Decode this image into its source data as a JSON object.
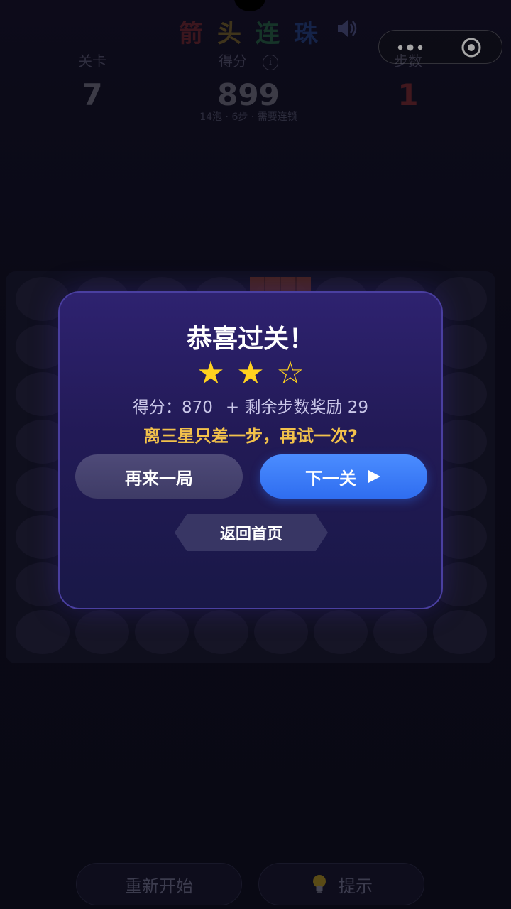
{
  "header": {
    "title_chars": [
      {
        "char": "箭",
        "color": "#e0443a"
      },
      {
        "char": "头",
        "color": "#f4c430"
      },
      {
        "char": "连",
        "color": "#3cc36b"
      },
      {
        "char": "珠",
        "color": "#3b7cf2"
      }
    ],
    "sound_icon": "speaker-icon",
    "capsule": {
      "menu_icon": "more-dots-icon",
      "close_icon": "target-close-icon"
    }
  },
  "stats": {
    "level": {
      "label": "关卡",
      "value": "7",
      "color": "#c9c9d6"
    },
    "score": {
      "label": "得分",
      "value": "899",
      "color": "#c9c9d6",
      "info_glyph": "i"
    },
    "steps": {
      "label": "步数",
      "value": "1",
      "color": "#e0443a"
    },
    "sub_info": "14泡 · 6步 · 需要连锁"
  },
  "board": {
    "rows": 8,
    "cols": 8
  },
  "bottom": {
    "restart_label": "重新开始",
    "hint_label": "提示",
    "hint_icon": "lightbulb-icon"
  },
  "dialog": {
    "title": "恭喜过关！",
    "stars_earned": 2,
    "stars_total": 3,
    "star_filled": "★",
    "star_empty": "☆",
    "score_label": "得分：",
    "score_value": "870",
    "bonus_text": "+ 剩余步数奖励 29",
    "encourage": "离三星只差一步，再试一次?",
    "retry_label": "再来一局",
    "next_label": "下一关",
    "home_label": "返回首页"
  }
}
